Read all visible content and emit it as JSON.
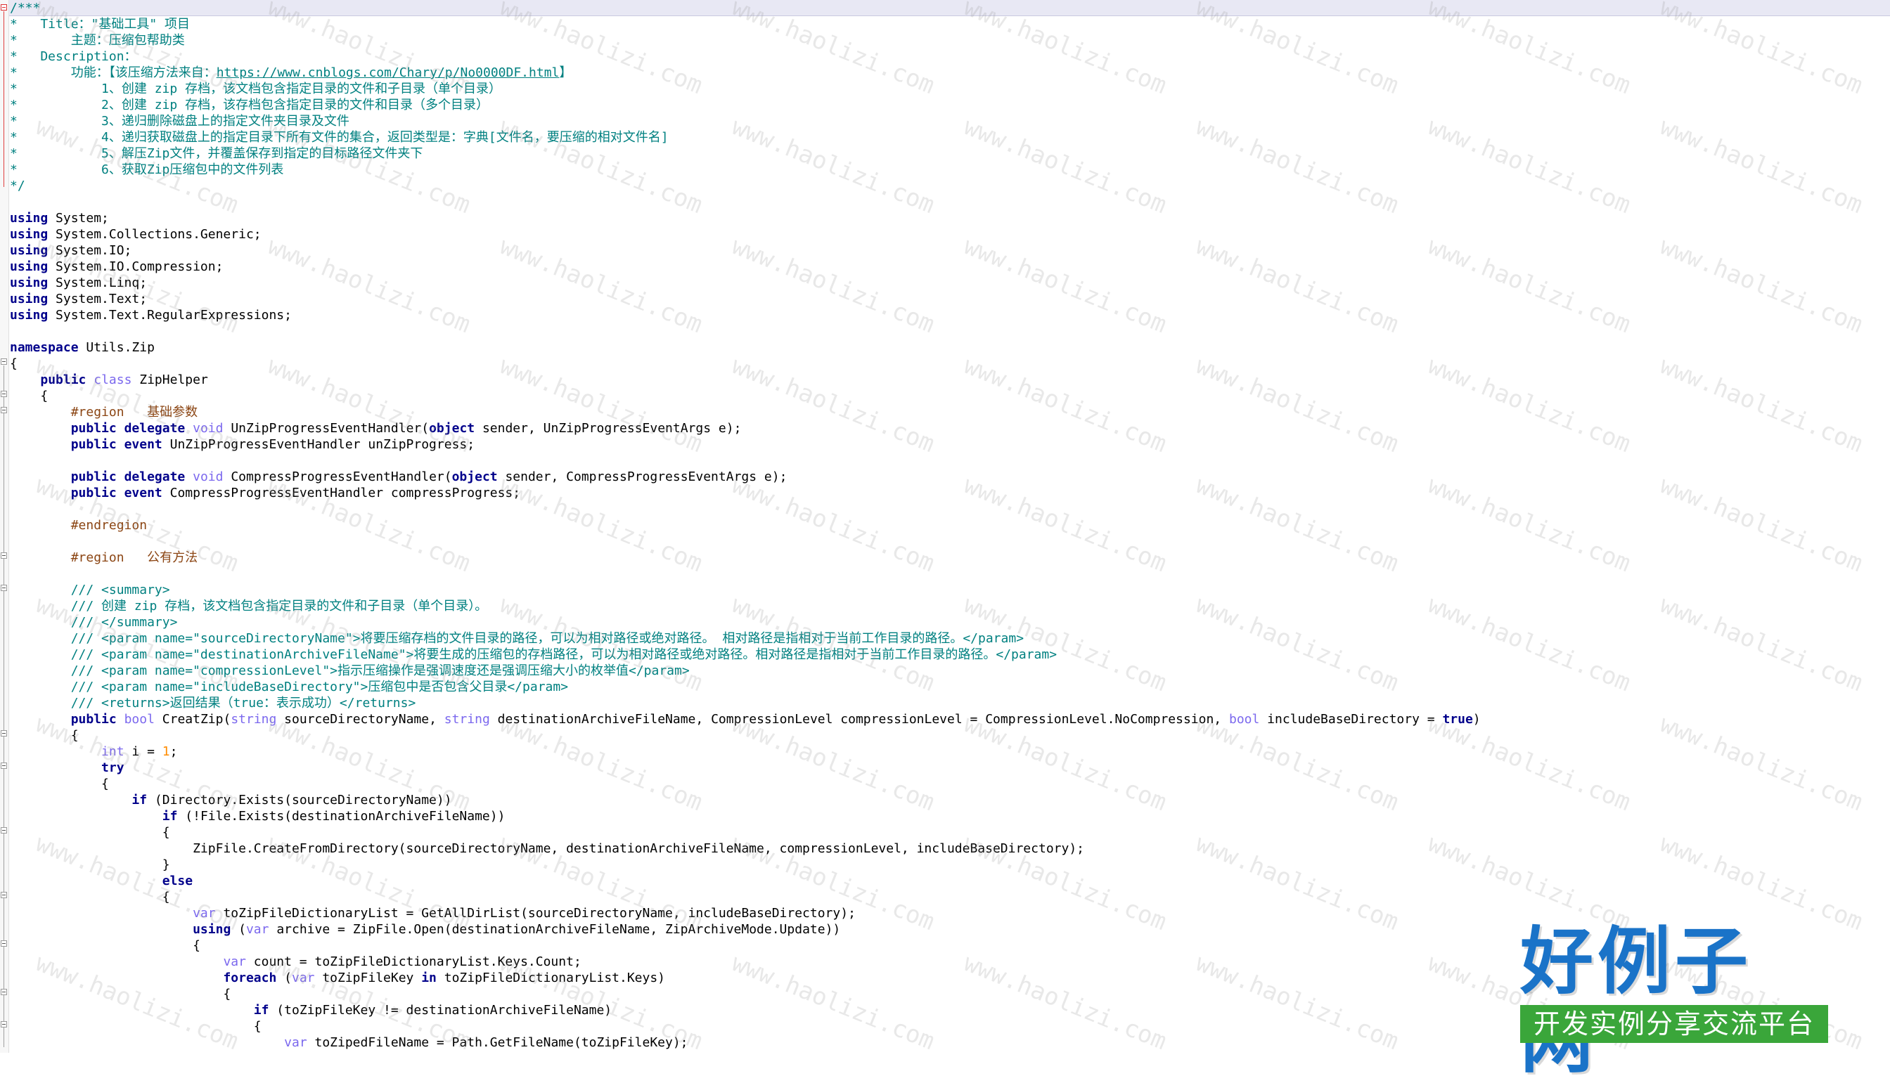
{
  "editor": {
    "lines": [
      {
        "t": "c",
        "v": "/***"
      },
      {
        "t": "c",
        "v": "*   Title：\"基础工具\" 项目"
      },
      {
        "t": "c",
        "v": "*       主题：压缩包帮助类"
      },
      {
        "t": "c",
        "v": "*   Description："
      },
      {
        "t": "mix",
        "parts": [
          [
            "c",
            "*       功能：【该压缩方法来自："
          ],
          [
            "lnk",
            "https://www.cnblogs.com/Chary/p/No0000DF.html"
          ],
          [
            "c",
            "】"
          ]
        ]
      },
      {
        "t": "c",
        "v": "*           1、创建 zip 存档，该文档包含指定目录的文件和子目录（单个目录）"
      },
      {
        "t": "c",
        "v": "*           2、创建 zip 存档，该存档包含指定目录的文件和目录（多个目录）"
      },
      {
        "t": "c",
        "v": "*           3、递归删除磁盘上的指定文件夹目录及文件"
      },
      {
        "t": "c",
        "v": "*           4、递归获取磁盘上的指定目录下所有文件的集合，返回类型是：字典[文件名，要压缩的相对文件名]"
      },
      {
        "t": "c",
        "v": "*           5、解压Zip文件，并覆盖保存到指定的目标路径文件夹下"
      },
      {
        "t": "c",
        "v": "*           6、获取Zip压缩包中的文件列表"
      },
      {
        "t": "c",
        "v": "*/"
      },
      {
        "t": "mix",
        "parts": []
      },
      {
        "t": "mix",
        "parts": [
          [
            "kw",
            "using"
          ],
          [
            "p",
            " System;"
          ]
        ]
      },
      {
        "t": "mix",
        "parts": [
          [
            "kw",
            "using"
          ],
          [
            "p",
            " System.Collections.Generic;"
          ]
        ]
      },
      {
        "t": "mix",
        "parts": [
          [
            "kw",
            "using"
          ],
          [
            "p",
            " System.IO;"
          ]
        ]
      },
      {
        "t": "mix",
        "parts": [
          [
            "kw",
            "using"
          ],
          [
            "p",
            " System.IO.Compression;"
          ]
        ]
      },
      {
        "t": "mix",
        "parts": [
          [
            "kw",
            "using"
          ],
          [
            "p",
            " System.Linq;"
          ]
        ]
      },
      {
        "t": "mix",
        "parts": [
          [
            "kw",
            "using"
          ],
          [
            "p",
            " System.Text;"
          ]
        ]
      },
      {
        "t": "mix",
        "parts": [
          [
            "kw",
            "using"
          ],
          [
            "p",
            " System.Text.RegularExpressions;"
          ]
        ]
      },
      {
        "t": "mix",
        "parts": []
      },
      {
        "t": "mix",
        "parts": [
          [
            "kw",
            "namespace"
          ],
          [
            "p",
            " Utils.Zip"
          ]
        ]
      },
      {
        "t": "mix",
        "parts": [
          [
            "p",
            "{"
          ]
        ]
      },
      {
        "t": "mix",
        "parts": [
          [
            "p",
            "    "
          ],
          [
            "kw",
            "public"
          ],
          [
            "p",
            " "
          ],
          [
            "kw2",
            "class"
          ],
          [
            "p",
            " ZipHelper"
          ]
        ]
      },
      {
        "t": "mix",
        "parts": [
          [
            "p",
            "    {"
          ]
        ]
      },
      {
        "t": "mix",
        "parts": [
          [
            "p",
            "        "
          ],
          [
            "reg",
            "#region   基础参数"
          ]
        ]
      },
      {
        "t": "mix",
        "parts": [
          [
            "p",
            "        "
          ],
          [
            "kw",
            "public"
          ],
          [
            "p",
            " "
          ],
          [
            "kw",
            "delegate"
          ],
          [
            "p",
            " "
          ],
          [
            "kw2",
            "void"
          ],
          [
            "p",
            " UnZipProgressEventHandler("
          ],
          [
            "kw",
            "object"
          ],
          [
            "p",
            " sender, UnZipProgressEventArgs e);"
          ]
        ]
      },
      {
        "t": "mix",
        "parts": [
          [
            "p",
            "        "
          ],
          [
            "kw",
            "public"
          ],
          [
            "p",
            " "
          ],
          [
            "kw",
            "event"
          ],
          [
            "p",
            " UnZipProgressEventHandler unZipProgress;"
          ]
        ]
      },
      {
        "t": "mix",
        "parts": []
      },
      {
        "t": "mix",
        "parts": [
          [
            "p",
            "        "
          ],
          [
            "kw",
            "public"
          ],
          [
            "p",
            " "
          ],
          [
            "kw",
            "delegate"
          ],
          [
            "p",
            " "
          ],
          [
            "kw2",
            "void"
          ],
          [
            "p",
            " CompressProgressEventHandler("
          ],
          [
            "kw",
            "object"
          ],
          [
            "p",
            " sender, CompressProgressEventArgs e);"
          ]
        ]
      },
      {
        "t": "mix",
        "parts": [
          [
            "p",
            "        "
          ],
          [
            "kw",
            "public"
          ],
          [
            "p",
            " "
          ],
          [
            "kw",
            "event"
          ],
          [
            "p",
            " CompressProgressEventHandler compressProgress;"
          ]
        ]
      },
      {
        "t": "mix",
        "parts": []
      },
      {
        "t": "mix",
        "parts": [
          [
            "p",
            "        "
          ],
          [
            "reg",
            "#endregion"
          ]
        ]
      },
      {
        "t": "mix",
        "parts": []
      },
      {
        "t": "mix",
        "parts": [
          [
            "p",
            "        "
          ],
          [
            "reg",
            "#region   公有方法"
          ]
        ]
      },
      {
        "t": "mix",
        "parts": []
      },
      {
        "t": "mix",
        "parts": [
          [
            "p",
            "        "
          ],
          [
            "c",
            "/// <summary>"
          ]
        ]
      },
      {
        "t": "mix",
        "parts": [
          [
            "p",
            "        "
          ],
          [
            "c",
            "/// 创建 zip 存档，该文档包含指定目录的文件和子目录（单个目录）。"
          ]
        ]
      },
      {
        "t": "mix",
        "parts": [
          [
            "p",
            "        "
          ],
          [
            "c",
            "/// </summary>"
          ]
        ]
      },
      {
        "t": "mix",
        "parts": [
          [
            "p",
            "        "
          ],
          [
            "c",
            "/// <param name=\"sourceDirectoryName\">将要压缩存档的文件目录的路径，可以为相对路径或绝对路径。 相对路径是指相对于当前工作目录的路径。</param>"
          ]
        ]
      },
      {
        "t": "mix",
        "parts": [
          [
            "p",
            "        "
          ],
          [
            "c",
            "/// <param name=\"destinationArchiveFileName\">将要生成的压缩包的存档路径，可以为相对路径或绝对路径。相对路径是指相对于当前工作目录的路径。</param>"
          ]
        ]
      },
      {
        "t": "mix",
        "parts": [
          [
            "p",
            "        "
          ],
          [
            "c",
            "/// <param name=\"compressionLevel\">指示压缩操作是强调速度还是强调压缩大小的枚举值</param>"
          ]
        ]
      },
      {
        "t": "mix",
        "parts": [
          [
            "p",
            "        "
          ],
          [
            "c",
            "/// <param name=\"includeBaseDirectory\">压缩包中是否包含父目录</param>"
          ]
        ]
      },
      {
        "t": "mix",
        "parts": [
          [
            "p",
            "        "
          ],
          [
            "c",
            "/// <returns>返回结果（true：表示成功）</returns>"
          ]
        ]
      },
      {
        "t": "mix",
        "parts": [
          [
            "p",
            "        "
          ],
          [
            "kw",
            "public"
          ],
          [
            "p",
            " "
          ],
          [
            "kw2",
            "bool"
          ],
          [
            "p",
            " CreatZip("
          ],
          [
            "kw2",
            "string"
          ],
          [
            "p",
            " sourceDirectoryName, "
          ],
          [
            "kw2",
            "string"
          ],
          [
            "p",
            " destinationArchiveFileName, CompressionLevel compressionLevel = CompressionLevel.NoCompression, "
          ],
          [
            "kw2",
            "bool"
          ],
          [
            "p",
            " includeBaseDirectory = "
          ],
          [
            "kw",
            "true"
          ],
          [
            "p",
            ")"
          ]
        ]
      },
      {
        "t": "mix",
        "parts": [
          [
            "p",
            "        {"
          ]
        ]
      },
      {
        "t": "mix",
        "parts": [
          [
            "p",
            "            "
          ],
          [
            "kw2",
            "int"
          ],
          [
            "p",
            " i = "
          ],
          [
            "num",
            "1"
          ],
          [
            "p",
            ";"
          ]
        ]
      },
      {
        "t": "mix",
        "parts": [
          [
            "p",
            "            "
          ],
          [
            "kw",
            "try"
          ]
        ]
      },
      {
        "t": "mix",
        "parts": [
          [
            "p",
            "            {"
          ]
        ]
      },
      {
        "t": "mix",
        "parts": [
          [
            "p",
            "                "
          ],
          [
            "kw",
            "if"
          ],
          [
            "p",
            " (Directory.Exists(sourceDirectoryName))"
          ]
        ]
      },
      {
        "t": "mix",
        "parts": [
          [
            "p",
            "                    "
          ],
          [
            "kw",
            "if"
          ],
          [
            "p",
            " (!File.Exists(destinationArchiveFileName))"
          ]
        ]
      },
      {
        "t": "mix",
        "parts": [
          [
            "p",
            "                    {"
          ]
        ]
      },
      {
        "t": "mix",
        "parts": [
          [
            "p",
            "                        ZipFile.CreateFromDirectory(sourceDirectoryName, destinationArchiveFileName, compressionLevel, includeBaseDirectory);"
          ]
        ]
      },
      {
        "t": "mix",
        "parts": [
          [
            "p",
            "                    }"
          ]
        ]
      },
      {
        "t": "mix",
        "parts": [
          [
            "p",
            "                    "
          ],
          [
            "kw",
            "else"
          ]
        ]
      },
      {
        "t": "mix",
        "parts": [
          [
            "p",
            "                    {"
          ]
        ]
      },
      {
        "t": "mix",
        "parts": [
          [
            "p",
            "                        "
          ],
          [
            "kw2",
            "var"
          ],
          [
            "p",
            " toZipFileDictionaryList = GetAllDirList(sourceDirectoryName, includeBaseDirectory);"
          ]
        ]
      },
      {
        "t": "mix",
        "parts": [
          [
            "p",
            "                        "
          ],
          [
            "kw",
            "using"
          ],
          [
            "p",
            " ("
          ],
          [
            "kw2",
            "var"
          ],
          [
            "p",
            " archive = ZipFile.Open(destinationArchiveFileName, ZipArchiveMode.Update))"
          ]
        ]
      },
      {
        "t": "mix",
        "parts": [
          [
            "p",
            "                        {"
          ]
        ]
      },
      {
        "t": "mix",
        "parts": [
          [
            "p",
            "                            "
          ],
          [
            "kw2",
            "var"
          ],
          [
            "p",
            " count = toZipFileDictionaryList.Keys.Count;"
          ]
        ]
      },
      {
        "t": "mix",
        "parts": [
          [
            "p",
            "                            "
          ],
          [
            "kw",
            "foreach"
          ],
          [
            "p",
            " ("
          ],
          [
            "kw2",
            "var"
          ],
          [
            "p",
            " toZipFileKey "
          ],
          [
            "kw",
            "in"
          ],
          [
            "p",
            " toZipFileDictionaryList.Keys)"
          ]
        ]
      },
      {
        "t": "mix",
        "parts": [
          [
            "p",
            "                            {"
          ]
        ]
      },
      {
        "t": "mix",
        "parts": [
          [
            "p",
            "                                "
          ],
          [
            "kw",
            "if"
          ],
          [
            "p",
            " (toZipFileKey != destinationArchiveFileName)"
          ]
        ]
      },
      {
        "t": "mix",
        "parts": [
          [
            "p",
            "                                {"
          ]
        ]
      },
      {
        "t": "mix",
        "parts": [
          [
            "p",
            "                                    "
          ],
          [
            "kw2",
            "var"
          ],
          [
            "p",
            " toZipedFileName = Path.GetFileName(toZipFileKey);"
          ]
        ]
      }
    ]
  },
  "watermark": {
    "text": "www.haolizi.com"
  },
  "logo": {
    "title": "好例子网",
    "subtitle": "开发实例分享交流平台"
  },
  "colors": {
    "comment": "#008080",
    "keyword": "#00008b",
    "type_keyword": "#7b68ee",
    "region": "#8b4513",
    "number": "#ff8c00"
  }
}
